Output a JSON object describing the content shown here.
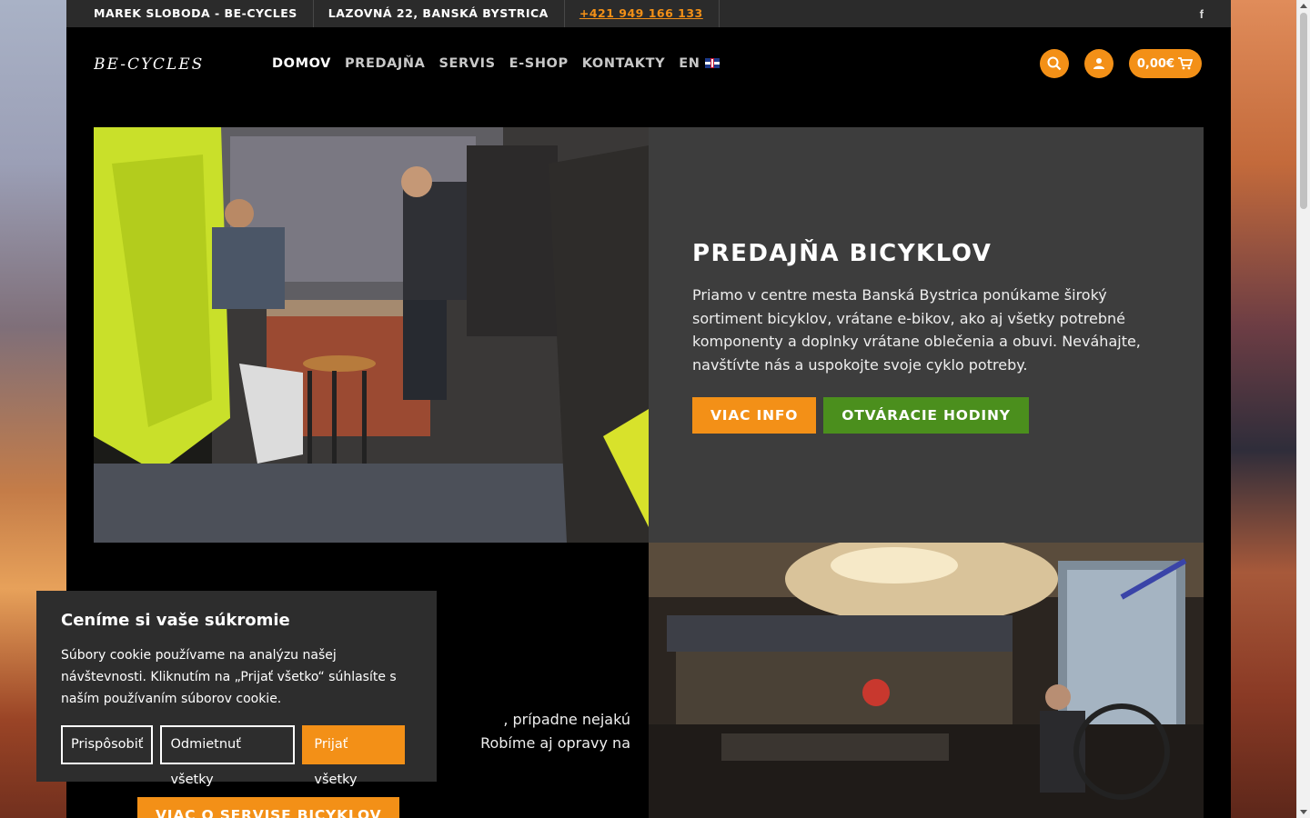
{
  "topbar": {
    "name": "MAREK SLOBODA - BE-CYCLES",
    "address": "LAZOVNÁ 22, BANSKÁ BYSTRICA",
    "phone": "+421 949 166 133"
  },
  "header": {
    "logo_text": "BE-CYCLES",
    "nav": [
      "DOMOV",
      "PREDAJŇA",
      "SERVIS",
      "E-SHOP",
      "KONTAKTY"
    ],
    "lang": "EN",
    "cart_total": "0,00€"
  },
  "hero": {
    "title": "PREDAJŇA BICYKLOV",
    "text": "Priamo v centre mesta Banská Bystrica ponúkame široký sortiment bicyklov, vrátane e-bikov, ako aj všetky potrebné komponenty a doplnky vrátane oblečenia a obuvi. Neváhajte, navštívte nás a uspokojte svoje cyklo potreby.",
    "btn_info": "VIAC INFO",
    "btn_hours": "OTVÁRACIE HODINY"
  },
  "service": {
    "text": ", prípadne nejakú\nRobíme aj opravy na",
    "btn": "VIAC O SERVISE BICYKLOV"
  },
  "cookie": {
    "title": "Ceníme si vaše súkromie",
    "text": "Súbory cookie používame na analýzu našej návštevnosti. Kliknutím na „Prijať všetko“ súhlasíte s naším používaním súborov cookie.",
    "btn_customize": "Prispôsobiť",
    "btn_reject": "Odmietnuť všetky",
    "btn_accept": "Prijať všetky"
  },
  "colors": {
    "accent": "#f39017",
    "green": "#4b8f1d",
    "panel": "#3d3d3d"
  }
}
